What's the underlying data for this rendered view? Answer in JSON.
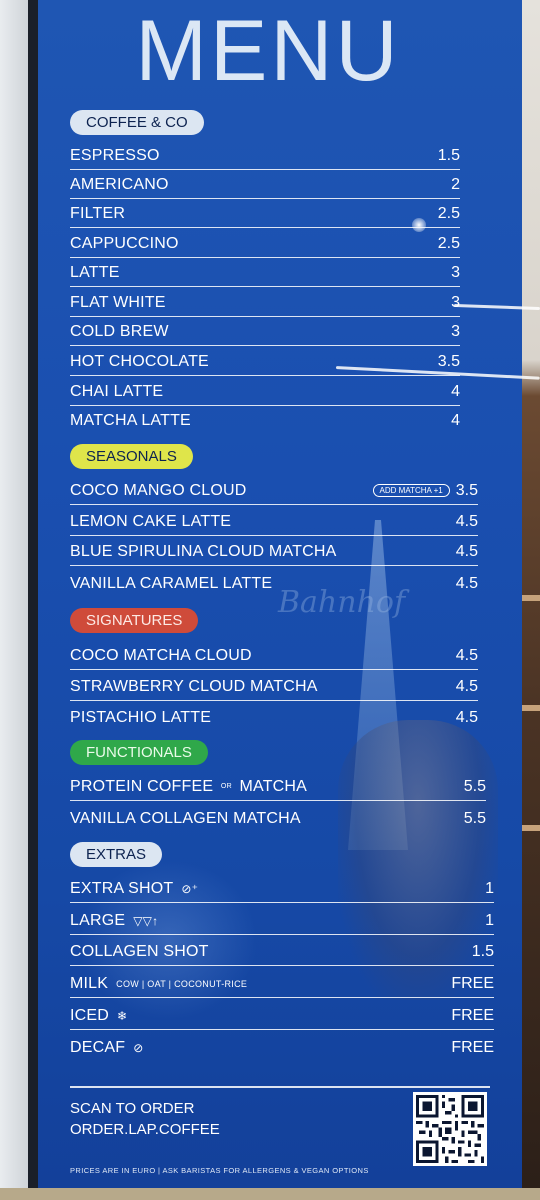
{
  "board": {
    "title": "MENU",
    "sections": {
      "coffee": {
        "label": "COFFEE & CO",
        "items": [
          {
            "name": "ESPRESSO",
            "price": "1.5"
          },
          {
            "name": "AMERICANO",
            "price": "2"
          },
          {
            "name": "FILTER",
            "price": "2.5"
          },
          {
            "name": "CAPPUCCINO",
            "price": "2.5"
          },
          {
            "name": "LATTE",
            "price": "3"
          },
          {
            "name": "FLAT WHITE",
            "price": "3"
          },
          {
            "name": "COLD BREW",
            "price": "3"
          },
          {
            "name": "HOT CHOCOLATE",
            "price": "3.5"
          },
          {
            "name": "CHAI LATTE",
            "price": "4"
          },
          {
            "name": "MATCHA LATTE",
            "price": "4"
          }
        ]
      },
      "seasonals": {
        "label": "SEASONALS",
        "items": [
          {
            "name": "COCO MANGO CLOUD",
            "price": "3.5",
            "badge": "ADD MATCHA +1"
          },
          {
            "name": "LEMON CAKE LATTE",
            "price": "4.5"
          },
          {
            "name": "BLUE SPIRULINA CLOUD MATCHA",
            "price": "4.5"
          },
          {
            "name": "VANILLA CARAMEL LATTE",
            "price": "4.5"
          }
        ]
      },
      "signatures": {
        "label": "SIGNATURES",
        "items": [
          {
            "name": "COCO MATCHA CLOUD",
            "price": "4.5"
          },
          {
            "name": "STRAWBERRY CLOUD MATCHA",
            "price": "4.5"
          },
          {
            "name": "PISTACHIO LATTE",
            "price": "4.5"
          }
        ]
      },
      "functionals": {
        "label": "FUNCTIONALS",
        "items": [
          {
            "name_a": "PROTEIN COFFEE",
            "connector": "OR",
            "name_b": "MATCHA",
            "price": "5.5"
          },
          {
            "name": "VANILLA COLLAGEN MATCHA",
            "price": "5.5"
          }
        ]
      },
      "extras": {
        "label": "EXTRAS",
        "items": [
          {
            "name": "EXTRA SHOT",
            "price": "1",
            "icon": "coffee-bean-icon"
          },
          {
            "name": "LARGE",
            "price": "1",
            "icon": "cup-size-icon"
          },
          {
            "name": "COLLAGEN SHOT",
            "price": "1.5"
          },
          {
            "name": "MILK",
            "price": "FREE",
            "note": "COW | OAT | COCONUT-RICE"
          },
          {
            "name": "ICED",
            "price": "FREE",
            "icon": "snowflake-icon"
          },
          {
            "name": "DECAF",
            "price": "FREE",
            "icon": "decaf-icon"
          }
        ]
      }
    },
    "order": {
      "line1": "SCAN TO ORDER",
      "line2": "ORDER.LAP.COFFEE"
    },
    "footnote": "PRICES ARE IN EURO | ASK BARISTAS FOR ALLERGENS & VEGAN OPTIONS",
    "colors": {
      "board_blue": "#1a4fb0",
      "seasonals_pill": "#dfe54a",
      "signatures_pill": "#cf4b3a",
      "functionals_pill": "#2fa84a",
      "neutral_pill": "#dce6f2"
    }
  }
}
